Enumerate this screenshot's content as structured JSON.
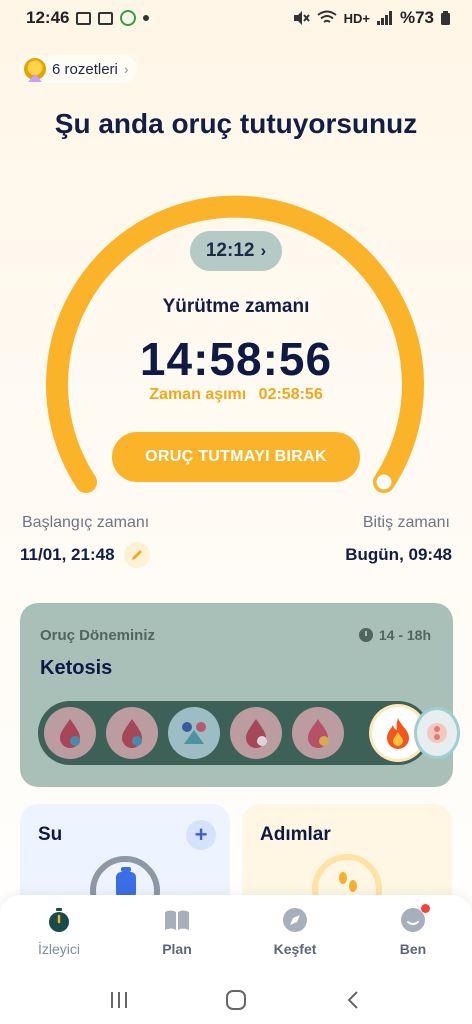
{
  "status_bar": {
    "time": "12:46",
    "network": "HD+",
    "battery": "%73"
  },
  "badge": {
    "label": "6 rozetleri"
  },
  "title": "Şu anda oruç tutuyorsunuz",
  "timer": {
    "plan_chip": "12:12",
    "elapsed_label": "Yürütme zamanı",
    "elapsed_time": "14:58:56",
    "overtime_label": "Zaman aşımı",
    "overtime_value": "02:58:56",
    "stop_button": "ORUÇ TUTMAYI BIRAK",
    "progress_fraction": 1.0
  },
  "schedule": {
    "start_label": "Başlangıç zamanı",
    "start_value": "11/01, 21:48",
    "end_label": "Bitiş zamanı",
    "end_value": "Bugün, 09:48"
  },
  "phase": {
    "label": "Oruç Döneminiz",
    "range": "14 - 18h",
    "name": "Ketosis",
    "stages": [
      "blood-sugar-rising-icon",
      "blood-sugar-falling-icon",
      "blood-sugar-normal-icon",
      "fat-burning-icon",
      "fat-burning-boost-icon",
      "ketosis-flame-icon",
      "autophagy-icon"
    ],
    "active_index": 5
  },
  "cards": {
    "water_title": "Su",
    "steps_title": "Adımlar"
  },
  "nav": {
    "items": [
      {
        "label": "İzleyici",
        "icon": "stopwatch-icon"
      },
      {
        "label": "Plan",
        "icon": "book-icon"
      },
      {
        "label": "Keşfet",
        "icon": "compass-icon"
      },
      {
        "label": "Ben",
        "icon": "profile-icon"
      }
    ]
  },
  "colors": {
    "accent": "#fbb32a",
    "navy": "#0f1a44",
    "phase_card": "#a9c0b9"
  }
}
